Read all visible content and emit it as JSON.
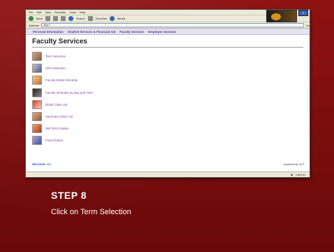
{
  "browser": {
    "menu": [
      "File",
      "Edit",
      "View",
      "Favorites",
      "Tools",
      "Help"
    ],
    "toolbar": [
      "Back",
      "Search",
      "Favorites",
      "Media"
    ],
    "address_label": "Address",
    "address_value": "https://",
    "go_label": "Go",
    "nav_tabs": [
      "Personal Information",
      "Student Services & Financial Aid",
      "Faculty Services",
      "Employee Services"
    ],
    "status": "Internet"
  },
  "page": {
    "title": "Faculty Services",
    "menu_items": [
      {
        "label": "Term Selection",
        "icon": "portrait-thumbnail"
      },
      {
        "label": "CRN Selection",
        "icon": "portrait-thumbnail"
      },
      {
        "label": "Faculty Detail Schedule",
        "icon": "portrait-thumbnail"
      },
      {
        "label": "Faculty Schedule by Day and Time",
        "icon": "portrait-thumbnail"
      },
      {
        "label": "Detail Class List",
        "icon": "portrait-thumbnail"
      },
      {
        "label": "Summary Class List",
        "icon": "portrait-thumbnail"
      },
      {
        "label": "Mid Term Grades",
        "icon": "portrait-thumbnail"
      },
      {
        "label": "Final Grades",
        "icon": "portrait-thumbnail"
      }
    ],
    "release": "RELEASE: 5.2"
  },
  "instruction": {
    "step": "STEP 8",
    "text": "Click on Term Selection"
  },
  "colors": {
    "background": "#8e1212",
    "link": "#7a3fa3",
    "nav_text": "#5b3f93"
  }
}
